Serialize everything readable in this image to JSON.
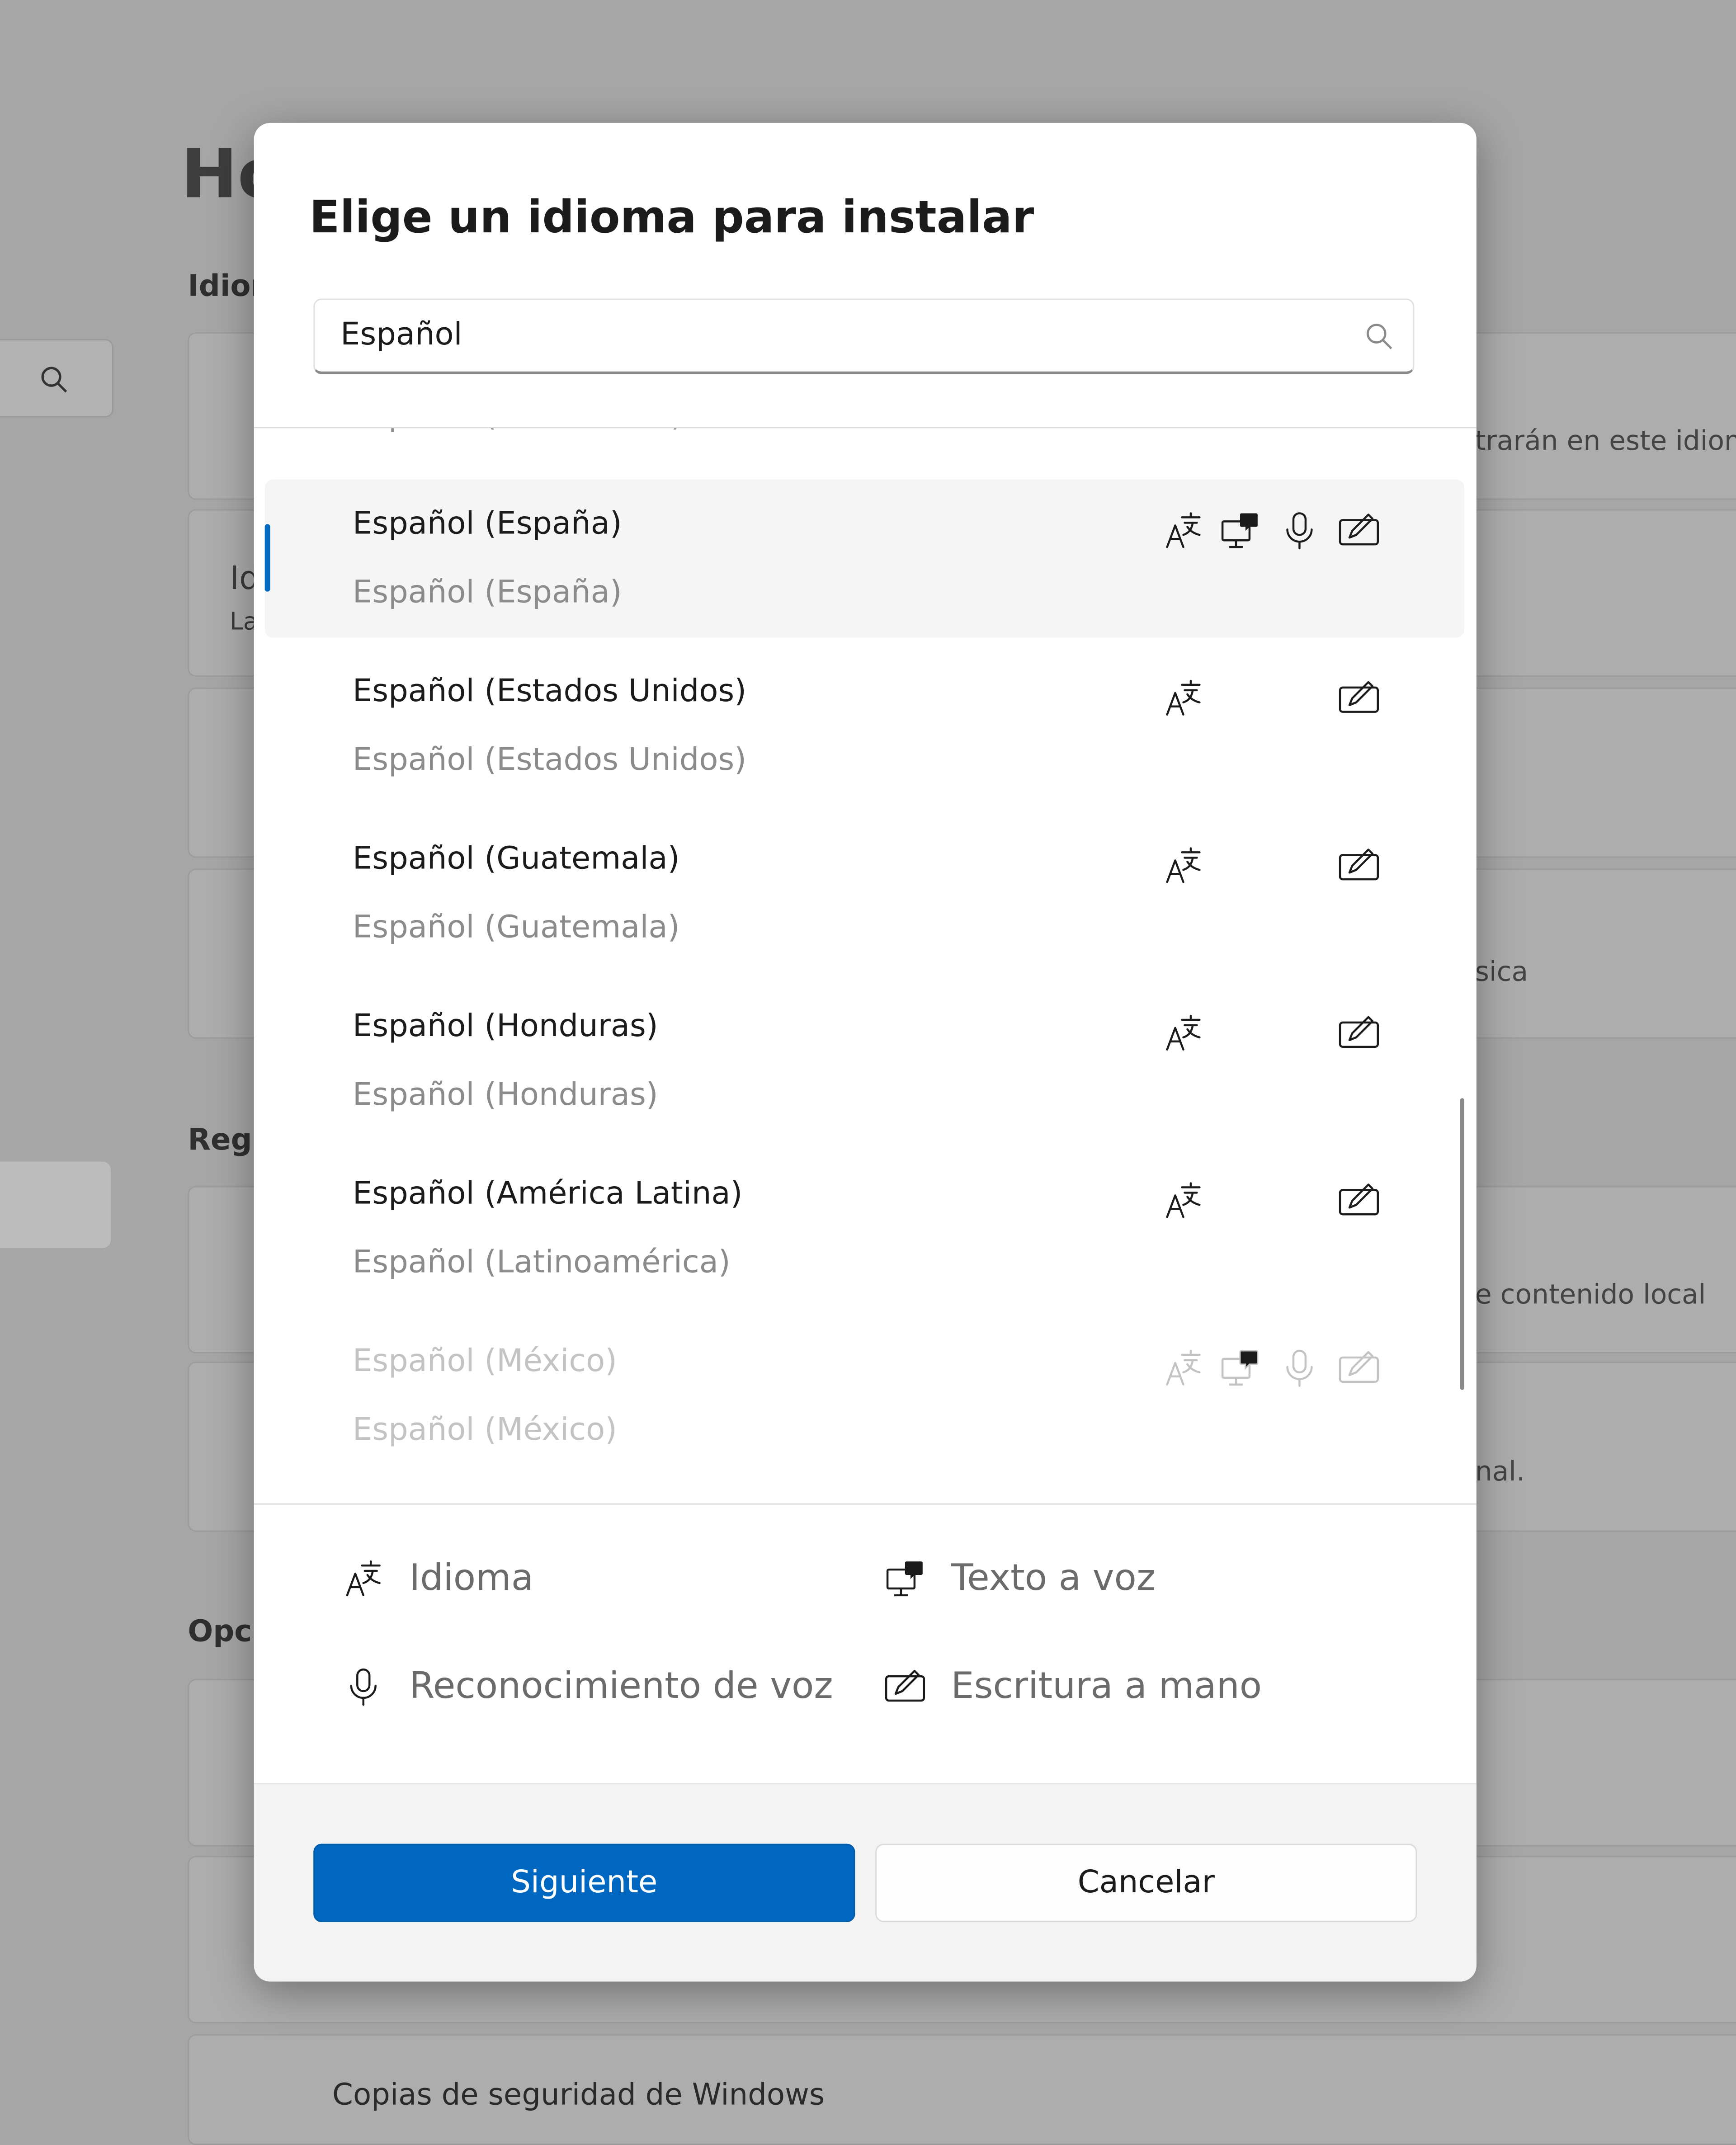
{
  "background": {
    "page_title": "Ho",
    "section_language": "Idior",
    "section_region": "Regi",
    "section_options": "Opci",
    "card_language_prefix": "Id",
    "card_language_sub_prefix": "La",
    "right_text_1": "trarán en este idiom",
    "right_text_2": "sica",
    "right_text_3": "e contenido local",
    "right_text_4": "nal.",
    "bottom_item": "Copias de seguridad de Windows"
  },
  "dialog": {
    "title": "Elige un idioma para instalar",
    "search": {
      "value": "Español"
    },
    "partial_row": "Español (El Salvador)",
    "languages": [
      {
        "name": "Español (España)",
        "native": "Español (España)",
        "features": [
          "language-pack-icon",
          "text-to-speech-icon",
          "microphone-icon",
          "handwriting-icon"
        ],
        "selected": true
      },
      {
        "name": "Español (Estados Unidos)",
        "native": "Español (Estados Unidos)",
        "features": [
          "language-pack-icon",
          "handwriting-icon"
        ]
      },
      {
        "name": "Español (Guatemala)",
        "native": "Español (Guatemala)",
        "features": [
          "language-pack-icon",
          "handwriting-icon"
        ]
      },
      {
        "name": "Español (Honduras)",
        "native": "Español (Honduras)",
        "features": [
          "language-pack-icon",
          "handwriting-icon"
        ]
      },
      {
        "name": "Español (América Latina)",
        "native": "Español (Latinoamérica)",
        "features": [
          "language-pack-icon",
          "handwriting-icon"
        ]
      },
      {
        "name": "Español (México)",
        "native": "Español (México)",
        "features": [
          "language-pack-icon",
          "text-to-speech-icon",
          "microphone-icon",
          "handwriting-icon"
        ],
        "faded": true
      }
    ],
    "legend": {
      "language": "Idioma",
      "tts": "Texto a voz",
      "speech": "Reconocimiento de voz",
      "handwriting": "Escritura a mano"
    },
    "buttons": {
      "next": "Siguiente",
      "cancel": "Cancelar"
    },
    "colors": {
      "accent": "#0067c0"
    }
  }
}
